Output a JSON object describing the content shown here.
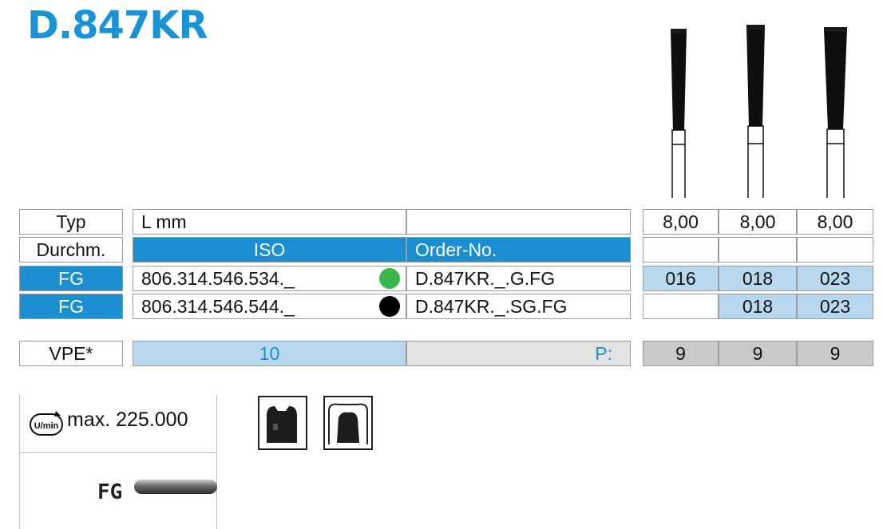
{
  "title": "D.847KR",
  "table": {
    "header_row": {
      "typ": "Typ",
      "l_mm": "L mm",
      "lengths": [
        "8,00",
        "8,00",
        "8,00"
      ]
    },
    "second_row": {
      "durchm": "Durchm.",
      "iso": "ISO",
      "order_no": "Order-No."
    },
    "rows": [
      {
        "type": "FG",
        "iso": "806.314.546.534._",
        "grit_color": "#3cb54a",
        "order": "D.847KR._.G.FG",
        "sizes": [
          "016",
          "018",
          "023"
        ]
      },
      {
        "type": "FG",
        "iso": "806.314.546.544._",
        "grit_color": "#000000",
        "order": "D.847KR._.SG.FG",
        "sizes": [
          "",
          "018",
          "023"
        ]
      }
    ],
    "vpe_row": {
      "label": "VPE*",
      "value": "10",
      "p_label": "P:",
      "p_values": [
        "9",
        "9",
        "9"
      ]
    }
  },
  "info": {
    "rpm_icon_text": "U/min",
    "rpm": "max. 225.000",
    "shank_label": "FG"
  },
  "icons": [
    "bur-image",
    "tooth-crown-icon",
    "tooth-inlay-icon",
    "rpm-icon",
    "fg-shank-icon"
  ]
}
